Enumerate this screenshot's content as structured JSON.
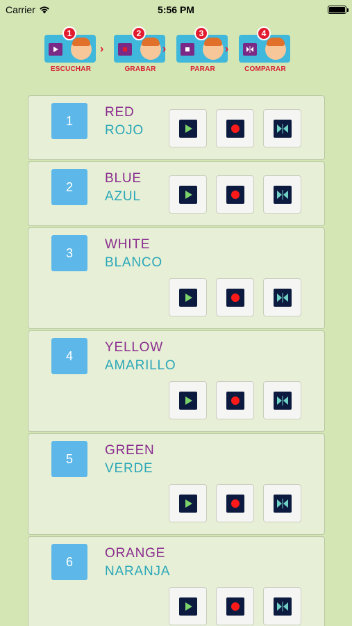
{
  "status": {
    "carrier": "Carrier",
    "time": "5:56 PM"
  },
  "steps": [
    {
      "number": "1",
      "label": "ESCUCHAR",
      "icon": "play-icon"
    },
    {
      "number": "2",
      "label": "GRABAR",
      "icon": "record-icon"
    },
    {
      "number": "3",
      "label": "PARAR",
      "icon": "stop-icon"
    },
    {
      "number": "4",
      "label": "COMPARAR",
      "icon": "compare-icon"
    }
  ],
  "colors": {
    "background": "#d3e6b4",
    "english": "#8a2c8e",
    "spanish": "#2aa6b8",
    "number_box": "#5db8e9",
    "step_label": "#d8202e"
  },
  "words": [
    {
      "number": "1",
      "english": "RED",
      "spanish": "ROJO"
    },
    {
      "number": "2",
      "english": "BLUE",
      "spanish": "AZUL"
    },
    {
      "number": "3",
      "english": "WHITE",
      "spanish": "BLANCO"
    },
    {
      "number": "4",
      "english": "YELLOW",
      "spanish": "AMARILLO"
    },
    {
      "number": "5",
      "english": "GREEN",
      "spanish": "VERDE"
    },
    {
      "number": "6",
      "english": "ORANGE",
      "spanish": "NARANJA"
    }
  ]
}
